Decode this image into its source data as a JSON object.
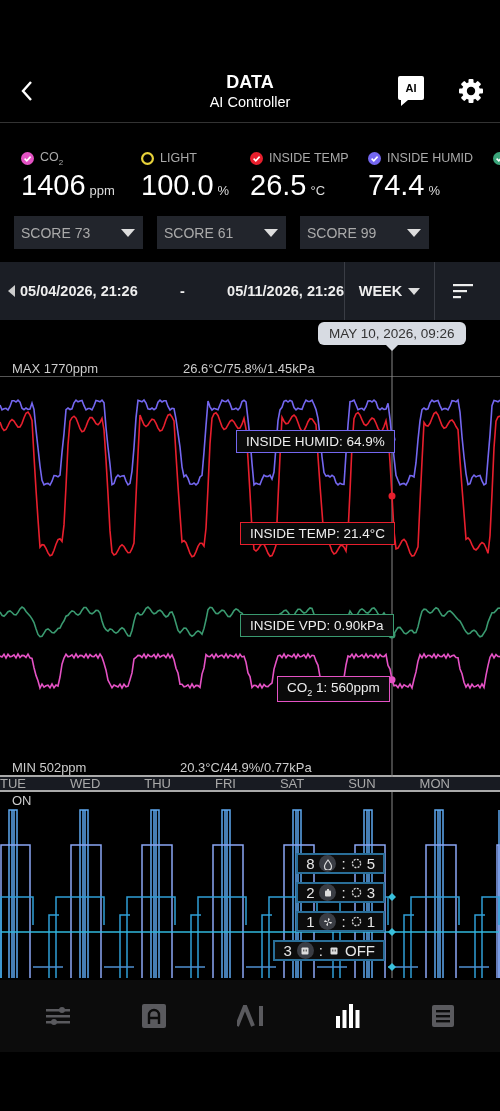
{
  "header": {
    "title": "DATA",
    "subtitle": "AI Controller",
    "ai_badge": "AI"
  },
  "sensors": [
    {
      "label": "CO$_{2}$",
      "value": "1406",
      "unit": "ppm",
      "color": "#e452c4",
      "checked": true
    },
    {
      "label": "LIGHT",
      "value": "100.0",
      "unit": "%",
      "color": "#e8d23a",
      "checked": false
    },
    {
      "label": "INSIDE TEMP",
      "value": "26.5",
      "unit": "°C",
      "color": "#e81f2d",
      "checked": true
    },
    {
      "label": "INSIDE HUMID",
      "value": "74.4",
      "unit": "%",
      "color": "#7467f0",
      "checked": true
    },
    {
      "color": "#3aa57a",
      "checked": true
    }
  ],
  "scores": [
    "SCORE 73",
    "SCORE 61",
    "SCORE 99"
  ],
  "range": {
    "start": "05/04/2026, 21:26",
    "separator": "-",
    "end": "05/11/2026, 21:26",
    "period": "WEEK"
  },
  "chart": {
    "cursor": "MAY 10, 2026, 09:26",
    "max": "MAX 1770ppm",
    "max_env": "26.6°C/75.8%/1.45kPa",
    "min": "MIN 502ppm",
    "min_env": "20.3°C/44.9%/0.77kPa",
    "readouts": [
      {
        "text": "INSIDE HUMID: 64.9%",
        "color": "#7467f0"
      },
      {
        "text": "INSIDE TEMP: 21.4°C",
        "color": "#e81f2d"
      },
      {
        "text": "INSIDE VPD: 0.90kPa",
        "color": "#3a9a70"
      },
      {
        "text": "CO$_{2}$ 1: 560ppm",
        "color": "#e452c4"
      }
    ],
    "days": [
      "TUE",
      "WED",
      "THU",
      "FRI",
      "SAT",
      "SUN",
      "MON"
    ]
  },
  "devices": {
    "state_label": "ON",
    "tags": [
      {
        "count": "8",
        "kind": "drop",
        "sep": ":",
        "value": "5"
      },
      {
        "count": "2",
        "kind": "heater",
        "sep": ":",
        "value": "3"
      },
      {
        "count": "1",
        "kind": "fan",
        "sep": ":",
        "value": "1"
      },
      {
        "count": "3",
        "kind": "outlet",
        "sep": ":",
        "value": "OFF"
      }
    ]
  },
  "nav": [
    {
      "kind": "sliders",
      "selected": false
    },
    {
      "kind": "arch",
      "selected": false
    },
    {
      "kind": "ai",
      "selected": false
    },
    {
      "kind": "bars",
      "selected": true
    },
    {
      "kind": "list",
      "selected": false
    }
  ]
}
